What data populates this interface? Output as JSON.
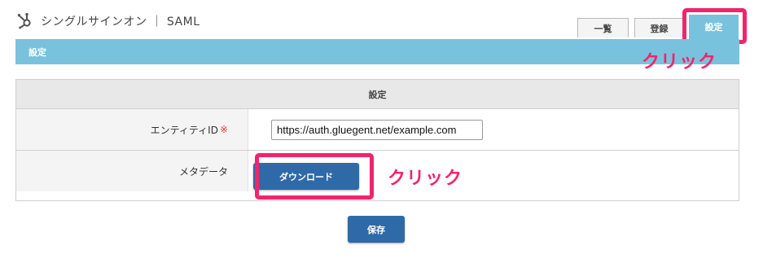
{
  "header": {
    "app_title": "シングルサインオン ｜ SAML",
    "logo_icon": "hubspot-sprocket-icon"
  },
  "tabs": [
    {
      "label": "一覧",
      "active": false
    },
    {
      "label": "登録",
      "active": false
    },
    {
      "label": "設定",
      "active": true
    }
  ],
  "section": {
    "title": "設定"
  },
  "form": {
    "heading": "設定",
    "entity_id": {
      "label": "エンティティID",
      "required_mark": "※",
      "value": "https://auth.gluegent.net/example.com"
    },
    "metadata": {
      "label": "メタデータ",
      "button_label": "ダウンロード"
    }
  },
  "annotations": {
    "click_label_1": "クリック",
    "click_label_2": "クリック"
  },
  "actions": {
    "save_label": "保存"
  },
  "colors": {
    "accent": "#79c2dd",
    "primary_button": "#2e6aa8",
    "highlight": "#f2246d",
    "required": "#e03a3a"
  }
}
